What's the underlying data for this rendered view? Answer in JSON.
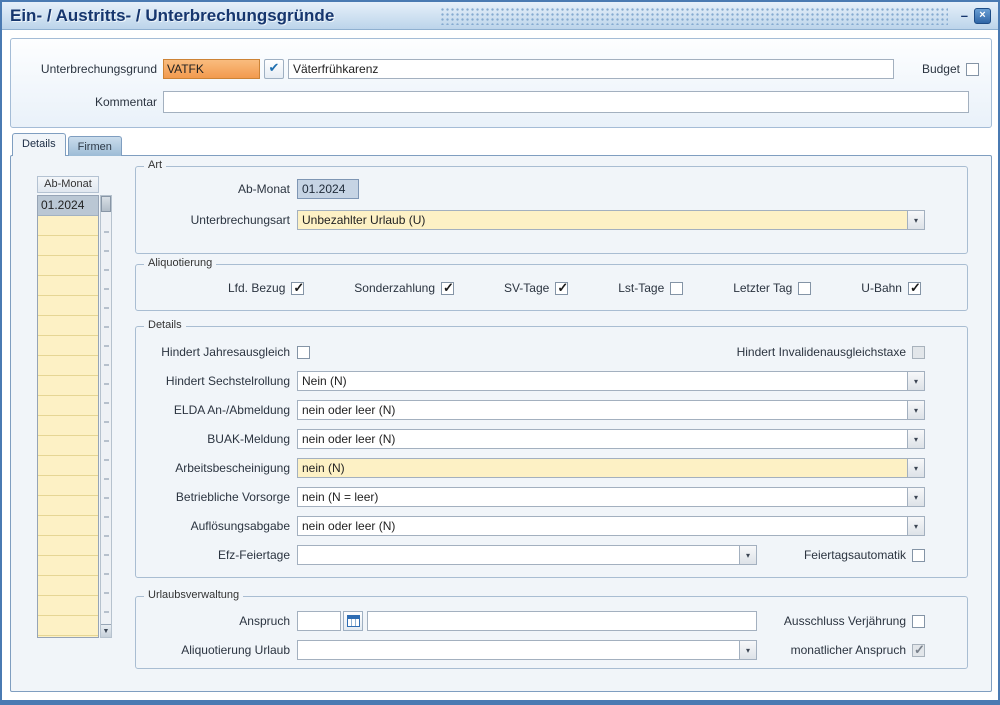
{
  "window": {
    "title": "Ein- / Austritts- / Unterbrechungsgründe"
  },
  "icons": {
    "dropdown": "▾",
    "check": "✔",
    "minimize": "–",
    "close": "×",
    "arrow_down": "▼"
  },
  "header": {
    "unterbrechungsgrund": {
      "label": "Unterbrechungsgrund",
      "code": "VATFK",
      "name": "Väterfrühkarenz"
    },
    "budget": {
      "label": "Budget",
      "checked": false
    },
    "kommentar": {
      "label": "Kommentar",
      "value": ""
    }
  },
  "tabs": [
    {
      "label": "Details",
      "active": true
    },
    {
      "label": "Firmen",
      "active": false
    }
  ],
  "list": {
    "header": "Ab-Monat",
    "items": [
      "01.2024"
    ],
    "selected": "01.2024"
  },
  "groups": {
    "art": {
      "title": "Art",
      "ab_monat_label": "Ab-Monat",
      "ab_monat_value": "01.2024",
      "unterbrechungsart_label": "Unterbrechungsart",
      "unterbrechungsart_value": "Unbezahlter Urlaub (U)",
      "unterbrechungsart_cream": true
    },
    "aliquotierung": {
      "title": "Aliquotierung",
      "checkboxes": [
        {
          "label": "Lfd. Bezug",
          "checked": true
        },
        {
          "label": "Sonderzahlung",
          "checked": true
        },
        {
          "label": "SV-Tage",
          "checked": true
        },
        {
          "label": "Lst-Tage",
          "checked": false
        },
        {
          "label": "Letzter Tag",
          "checked": false
        },
        {
          "label": "U-Bahn",
          "checked": true
        }
      ]
    },
    "details": {
      "title": "Details",
      "jahresausgleich": {
        "label": "Hindert Jahresausgleich",
        "checked": false
      },
      "invalidenausgleichstaxe": {
        "label": "Hindert Invalidenausgleichstaxe",
        "checked": false
      },
      "rows": [
        {
          "label": "Hindert Sechstelrollung",
          "value": "Nein (N)",
          "cream": false
        },
        {
          "label": "ELDA An-/Abmeldung",
          "value": "nein oder leer (N)",
          "cream": false
        },
        {
          "label": "BUAK-Meldung",
          "value": "nein oder leer (N)",
          "cream": false
        },
        {
          "label": "Arbeitsbescheinigung",
          "value": "nein (N)",
          "cream": true
        },
        {
          "label": "Betriebliche Vorsorge",
          "value": "nein (N = leer)",
          "cream": false
        },
        {
          "label": "Auflösungsabgabe",
          "value": "nein oder leer (N)",
          "cream": false
        }
      ],
      "efz": {
        "label": "Efz-Feiertage",
        "value": ""
      },
      "feiertagsautomatik": {
        "label": "Feiertagsautomatik",
        "checked": false
      }
    },
    "urlaubsverwaltung": {
      "title": "Urlaubsverwaltung",
      "anspruch": {
        "label": "Anspruch",
        "value": "",
        "text": ""
      },
      "ausschluss_verjaehrung": {
        "label": "Ausschluss Verjährung",
        "checked": false
      },
      "aliquotierung_urlaub": {
        "label": "Aliquotierung Urlaub",
        "value": ""
      },
      "monatlicher_anspruch": {
        "label": "monatlicher Anspruch",
        "checked": true
      }
    }
  },
  "colors": {
    "accent_orange": "#f5a55e",
    "cream_field": "#fdf1c5",
    "selected_row": "#bac7d4",
    "readonly_blue": "#c6d4e4",
    "title_text": "#16366e",
    "window_border": "#4a7ab2"
  }
}
